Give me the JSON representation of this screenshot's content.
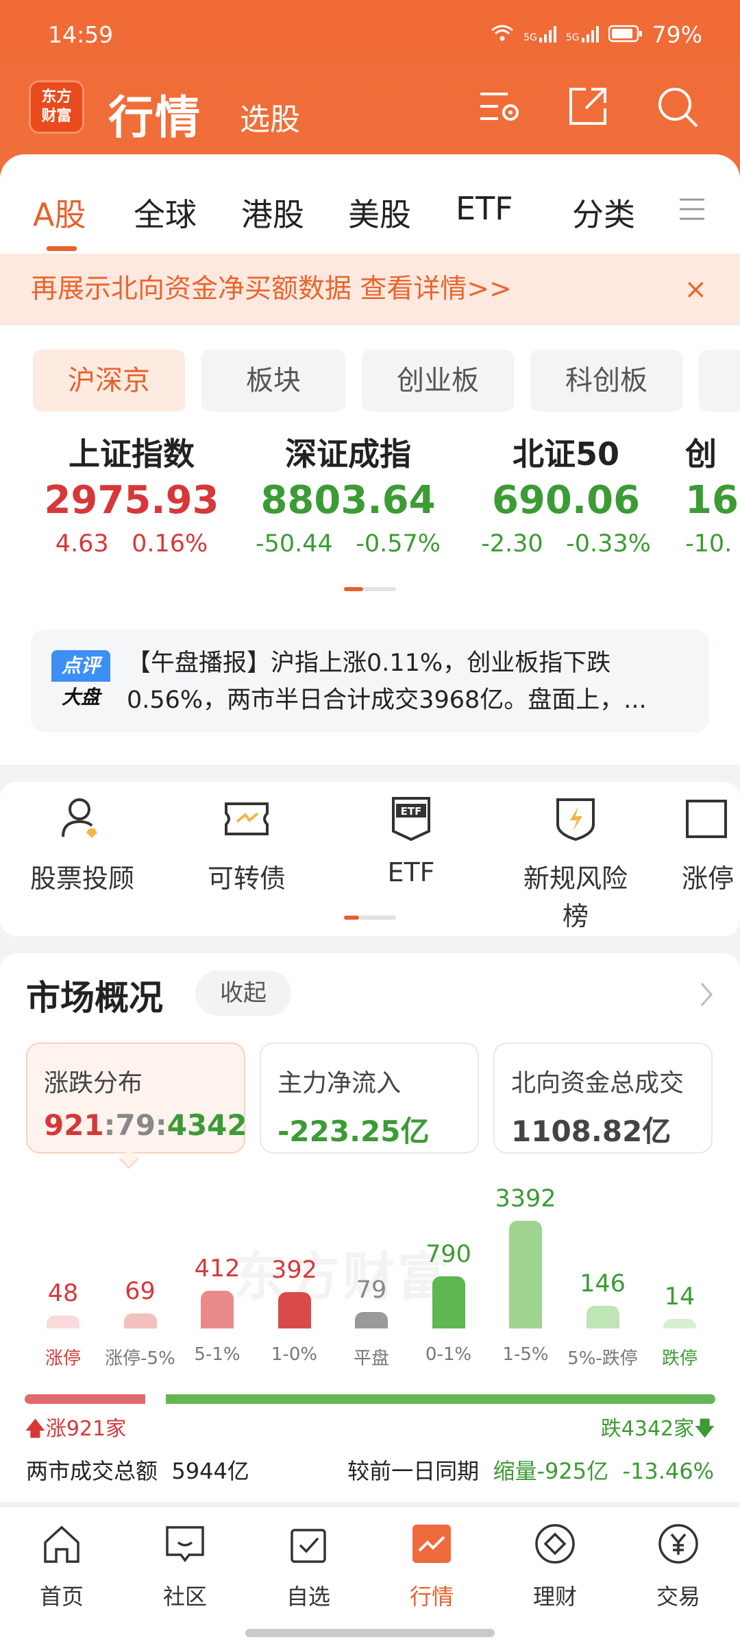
{
  "status_bar": {
    "time": "14:59",
    "battery": "79%",
    "signal1": "5G",
    "signal2": "5G"
  },
  "header": {
    "brand_line1": "东方",
    "brand_line2": "财富",
    "title": "行情",
    "subtitle": "选股"
  },
  "colors": {
    "accent": "#e8602c",
    "up": "#d6383a",
    "down": "#3c9b34",
    "header": "#f06a35"
  },
  "market_tabs": [
    "A股",
    "全球",
    "港股",
    "美股",
    "ETF",
    "分类"
  ],
  "banner": {
    "text": "再展示北向资金净买额数据 查看详情>>",
    "close": "×"
  },
  "segments": [
    "沪深京",
    "板块",
    "创业板",
    "科创板"
  ],
  "indices": [
    {
      "name": "上证指数",
      "value": "2975.93",
      "change": "4.63",
      "pct": "0.16%",
      "dir": "up"
    },
    {
      "name": "深证成指",
      "value": "8803.64",
      "change": "-50.44",
      "pct": "-0.57%",
      "dir": "down"
    },
    {
      "name": "北证50",
      "value": "690.06",
      "change": "-2.30",
      "pct": "-0.33%",
      "dir": "down"
    },
    {
      "name": "创",
      "value": "16",
      "change": "-10.",
      "pct": "",
      "dir": "down"
    }
  ],
  "news": {
    "tag1": "点评",
    "tag2": "大盘",
    "line1": "【午盘播报】沪指上涨0.11%，创业板指下跌",
    "line2": "0.56%，两市半日合计成交3968亿。盘面上，..."
  },
  "features": [
    "股票投顾",
    "可转债",
    "ETF",
    "新规风险榜",
    "涨停"
  ],
  "overview": {
    "title": "市场概况",
    "collapse": "收起",
    "boxes": [
      {
        "label": "涨跌分布",
        "up": "921",
        "flat": "79",
        "down": "4342",
        "sep": ":"
      },
      {
        "label": "主力净流入",
        "value": "-223.25亿"
      },
      {
        "label": "北向资金总成交",
        "value": "1108.82亿"
      }
    ],
    "watermark": "东方财富",
    "distribution": [
      {
        "label": "涨停",
        "value": 48,
        "color": "#d6383a",
        "fill": "#f8dada"
      },
      {
        "label": "涨停-5%",
        "value": 69,
        "color": "#d6383a",
        "fill": "#f3c0c0"
      },
      {
        "label": "5-1%",
        "value": 412,
        "color": "#d6383a",
        "fill": "#e88a8a"
      },
      {
        "label": "1-0%",
        "value": 392,
        "color": "#d6383a",
        "fill": "#d94b4b"
      },
      {
        "label": "平盘",
        "value": 79,
        "color": "#888888",
        "fill": "#999999"
      },
      {
        "label": "0-1%",
        "value": 790,
        "color": "#3c9b34",
        "fill": "#5cb84f"
      },
      {
        "label": "1-5%",
        "value": 3392,
        "color": "#3c9b34",
        "fill": "#9ed48f"
      },
      {
        "label": "5%-跌停",
        "value": 146,
        "color": "#3c9b34",
        "fill": "#bfe4b5"
      },
      {
        "label": "跌停",
        "value": 14,
        "color": "#3c9b34",
        "fill": "#d8eed2"
      }
    ],
    "up_text": "涨921家",
    "down_text": "跌4342家",
    "up_ratio": 0.175,
    "turnover_label": "两市成交总额",
    "turnover_value": "5944亿",
    "compare_label": "较前一日同期",
    "compare_value": "缩量-925亿",
    "compare_pct": "-13.46%"
  },
  "bottom_nav": [
    "首页",
    "社区",
    "自选",
    "行情",
    "理财",
    "交易"
  ]
}
